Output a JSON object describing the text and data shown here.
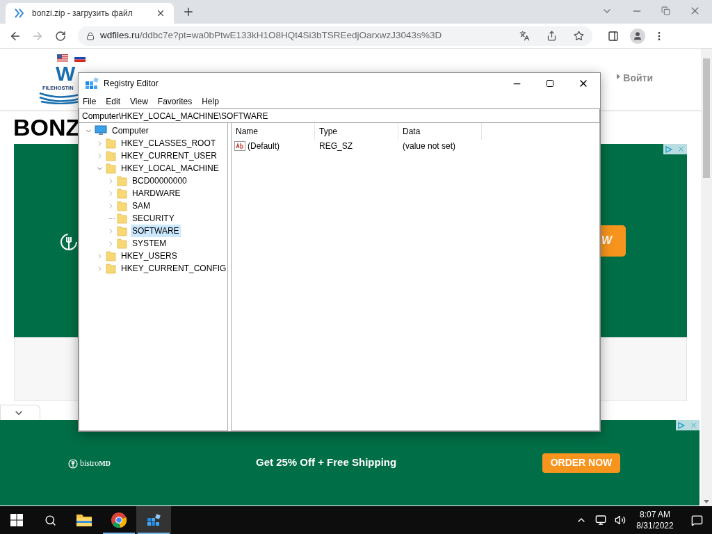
{
  "browser": {
    "tab": {
      "title": "bonzi.zip - загрузить файл"
    },
    "url": {
      "host": "wdfiles.ru",
      "path": "/ddbc7e?pt=wa0bPtwE133kH1O8HQt4Si3bTSREedjOarxwzJ3043s%3D"
    }
  },
  "page": {
    "logo": {
      "letters": "W",
      "tagline": "FILEHOSTIN"
    },
    "login": "Войти",
    "heading": "BONZ",
    "ad_top": {
      "button": "W"
    },
    "ad_bottom": {
      "brand": "bistro",
      "brand_suffix": "MD",
      "headline": "Get 25% Off + Free Shipping",
      "button": "ORDER NOW"
    }
  },
  "regedit": {
    "title": "Registry Editor",
    "menu": [
      "File",
      "Edit",
      "View",
      "Favorites",
      "Help"
    ],
    "path": "Computer\\HKEY_LOCAL_MACHINE\\SOFTWARE",
    "tree": [
      {
        "label": "Computer",
        "expandable": true,
        "expanded": true,
        "selected": false,
        "children": [
          {
            "label": "HKEY_CLASSES_ROOT",
            "expandable": true,
            "expanded": false,
            "selected": false
          },
          {
            "label": "HKEY_CURRENT_USER",
            "expandable": true,
            "expanded": false,
            "selected": false
          },
          {
            "label": "HKEY_LOCAL_MACHINE",
            "expandable": true,
            "expanded": true,
            "selected": false,
            "children": [
              {
                "label": "BCD00000000",
                "expandable": true,
                "expanded": false,
                "selected": false
              },
              {
                "label": "HARDWARE",
                "expandable": true,
                "expanded": false,
                "selected": false
              },
              {
                "label": "SAM",
                "expandable": true,
                "expanded": false,
                "selected": false
              },
              {
                "label": "SECURITY",
                "expandable": false,
                "expanded": false,
                "selected": false
              },
              {
                "label": "SOFTWARE",
                "expandable": true,
                "expanded": false,
                "selected": true
              },
              {
                "label": "SYSTEM",
                "expandable": true,
                "expanded": false,
                "selected": false
              }
            ]
          },
          {
            "label": "HKEY_USERS",
            "expandable": true,
            "expanded": false,
            "selected": false
          },
          {
            "label": "HKEY_CURRENT_CONFIG",
            "expandable": true,
            "expanded": false,
            "selected": false
          }
        ]
      }
    ],
    "columns": [
      "Name",
      "Type",
      "Data"
    ],
    "values": [
      {
        "name": "(Default)",
        "type": "REG_SZ",
        "data": "(value not set)"
      }
    ]
  },
  "taskbar": {
    "apps": [
      {
        "kind": "folder",
        "running": false,
        "selected": false
      },
      {
        "kind": "chrome",
        "running": true,
        "selected": false
      },
      {
        "kind": "regedit",
        "running": true,
        "selected": true
      }
    ],
    "time": "8:07 AM",
    "date": "8/31/2022"
  }
}
